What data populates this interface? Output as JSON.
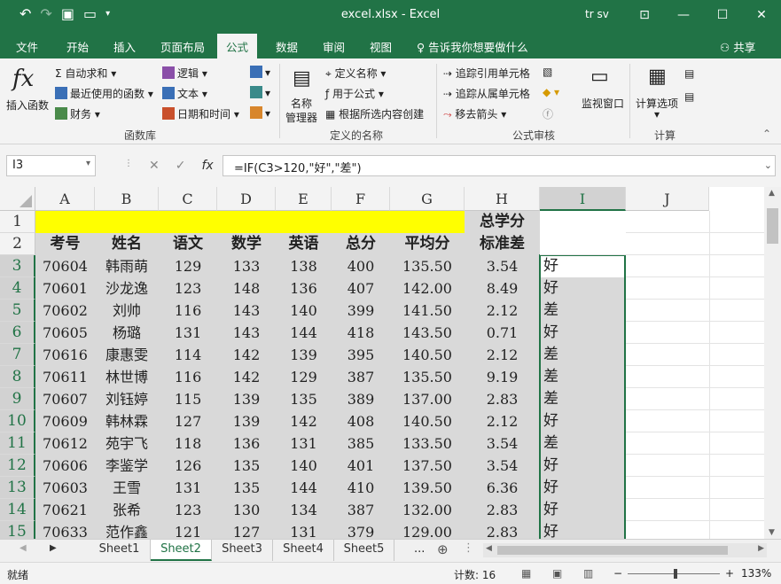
{
  "window": {
    "file_title": "excel.xlsx  -  Excel",
    "user": "tr sv"
  },
  "tabs": [
    "文件",
    "开始",
    "插入",
    "页面布局",
    "公式",
    "数据",
    "审阅",
    "视图"
  ],
  "active_tab": "公式",
  "tell_me": "告诉我你想要做什么",
  "share": "共享",
  "ribbon": {
    "insert_function": "插入函数",
    "autosum": "自动求和",
    "recent": "最近使用的函数",
    "financial": "财务",
    "logical": "逻辑",
    "text": "文本",
    "datetime": "日期和时间",
    "group_library": "函数库",
    "name_manager_1": "名称",
    "name_manager_2": "管理器",
    "define_name": "定义名称",
    "use_in_formula": "用于公式",
    "create_from_sel": "根据所选内容创建",
    "group_names": "定义的名称",
    "trace_precedents": "追踪引用单元格",
    "trace_dependents": "追踪从属单元格",
    "remove_arrows": "移去箭头",
    "watch_window": "监视窗口",
    "group_audit": "公式审核",
    "calc_options": "计算选项",
    "group_calc": "计算"
  },
  "formula_bar": {
    "name_box": "I3",
    "formula": "=IF(C3>120,\"好\",\"差\")"
  },
  "columns": [
    "A",
    "B",
    "C",
    "D",
    "E",
    "F",
    "G",
    "H",
    "I",
    "J"
  ],
  "row_numbers": [
    "1",
    "2",
    "3",
    "4",
    "5",
    "6",
    "7",
    "8",
    "9",
    "10",
    "11",
    "12",
    "13",
    "14",
    "15"
  ],
  "h1_text": "总学分",
  "headers": [
    "考号",
    "姓名",
    "语文",
    "数学",
    "英语",
    "总分",
    "平均分",
    "标准差"
  ],
  "rows": [
    [
      "70604",
      "韩雨萌",
      "129",
      "133",
      "138",
      "400",
      "135.50",
      "3.54",
      "好"
    ],
    [
      "70601",
      "沙龙逸",
      "123",
      "148",
      "136",
      "407",
      "142.00",
      "8.49",
      "好"
    ],
    [
      "70602",
      "刘帅",
      "116",
      "143",
      "140",
      "399",
      "141.50",
      "2.12",
      "差"
    ],
    [
      "70605",
      "杨璐",
      "131",
      "143",
      "144",
      "418",
      "143.50",
      "0.71",
      "好"
    ],
    [
      "70616",
      "康惠雯",
      "114",
      "142",
      "139",
      "395",
      "140.50",
      "2.12",
      "差"
    ],
    [
      "70611",
      "林世博",
      "116",
      "142",
      "129",
      "387",
      "135.50",
      "9.19",
      "差"
    ],
    [
      "70607",
      "刘钰婷",
      "115",
      "139",
      "135",
      "389",
      "137.00",
      "2.83",
      "差"
    ],
    [
      "70609",
      "韩林霖",
      "127",
      "139",
      "142",
      "408",
      "140.50",
      "2.12",
      "好"
    ],
    [
      "70612",
      "苑宇飞",
      "118",
      "136",
      "131",
      "385",
      "133.50",
      "3.54",
      "差"
    ],
    [
      "70606",
      "李鉴学",
      "126",
      "135",
      "140",
      "401",
      "137.50",
      "3.54",
      "好"
    ],
    [
      "70603",
      "王雪",
      "131",
      "135",
      "144",
      "410",
      "139.50",
      "6.36",
      "好"
    ],
    [
      "70621",
      "张希",
      "123",
      "130",
      "134",
      "387",
      "132.00",
      "2.83",
      "好"
    ],
    [
      "70633",
      "范作鑫",
      "121",
      "127",
      "131",
      "379",
      "129.00",
      "2.83",
      "好"
    ]
  ],
  "sheets": [
    "Sheet1",
    "Sheet2",
    "Sheet3",
    "Sheet4",
    "Sheet5"
  ],
  "active_sheet": "Sheet2",
  "status": {
    "ready": "就绪",
    "count": "计数: 16",
    "zoom": "133%"
  },
  "colors": {
    "excel_green": "#217346",
    "highlight_yellow": "#ffff00",
    "cell_gray": "#d9d9d9"
  }
}
